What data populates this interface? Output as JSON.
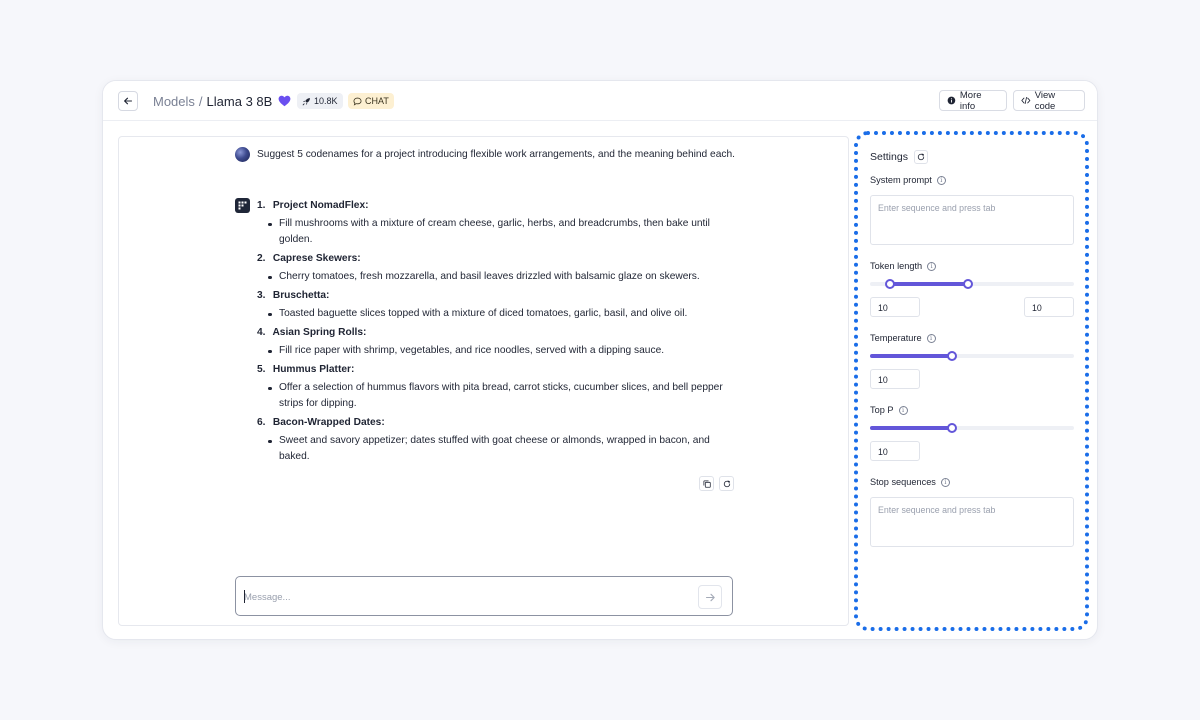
{
  "header": {
    "breadcrumb_root": "Models",
    "breadcrumb_sep": "/",
    "model_name": "Llama 3 8B",
    "likes": "10.8K",
    "chat_badge": "CHAT",
    "more_info_label": "More info",
    "view_code_label": "View code"
  },
  "chat": {
    "user_message": "Suggest 5 codenames for a project introducing flexible work arrangements, and the meaning behind each.",
    "response_items": [
      {
        "num": "1.",
        "title": "Project NomadFlex:",
        "desc": "Fill mushrooms with a mixture of cream cheese, garlic, herbs, and breadcrumbs, then bake until golden."
      },
      {
        "num": "2.",
        "title": "Caprese Skewers:",
        "desc": "Cherry tomatoes, fresh mozzarella, and basil leaves drizzled with balsamic glaze on skewers."
      },
      {
        "num": "3.",
        "title": "Bruschetta:",
        "desc": "Toasted baguette slices topped with a mixture of diced tomatoes, garlic, basil, and olive oil."
      },
      {
        "num": "4.",
        "title": "Asian Spring Rolls:",
        "desc": "Fill rice paper with shrimp, vegetables, and rice noodles, served with a dipping sauce."
      },
      {
        "num": "5.",
        "title": "Hummus Platter:",
        "desc": "Offer a selection of hummus flavors with pita bread, carrot sticks, cucumber slices, and bell pepper strips for dipping."
      },
      {
        "num": "6.",
        "title": "Bacon-Wrapped Dates:",
        "desc": "Sweet and savory appetizer; dates stuffed with goat cheese or almonds, wrapped in bacon, and baked."
      }
    ],
    "message_placeholder": "Message...",
    "message_value": ""
  },
  "settings": {
    "title": "Settings",
    "system_prompt_label": "System prompt",
    "system_prompt_placeholder": "Enter sequence and press tab",
    "token_length_label": "Token length",
    "token_length_min": "10",
    "token_length_max": "10",
    "token_length_range_fraction": [
      0.1,
      0.48
    ],
    "temperature_label": "Temperature",
    "temperature_value": "10",
    "temperature_fraction": 0.4,
    "top_p_label": "Top P",
    "top_p_value": "10",
    "top_p_fraction": 0.4,
    "stop_sequences_label": "Stop sequences",
    "stop_sequences_placeholder": "Enter sequence and press tab",
    "info_glyph": "i"
  },
  "colors": {
    "accent": "#6356d9",
    "highlight_border": "#1a6de8",
    "chat_badge_bg": "#fdf0d2",
    "heart": "#6a4ff0"
  },
  "icons": {
    "back": "arrow-left-icon",
    "heart": "heart-icon",
    "likes": "rocket-icon",
    "chat": "chat-bubble-icon",
    "more_info": "info-circle-icon",
    "view_code": "code-icon",
    "copy": "copy-icon",
    "regenerate": "refresh-icon",
    "send": "arrow-right-icon",
    "reset": "refresh-icon"
  }
}
